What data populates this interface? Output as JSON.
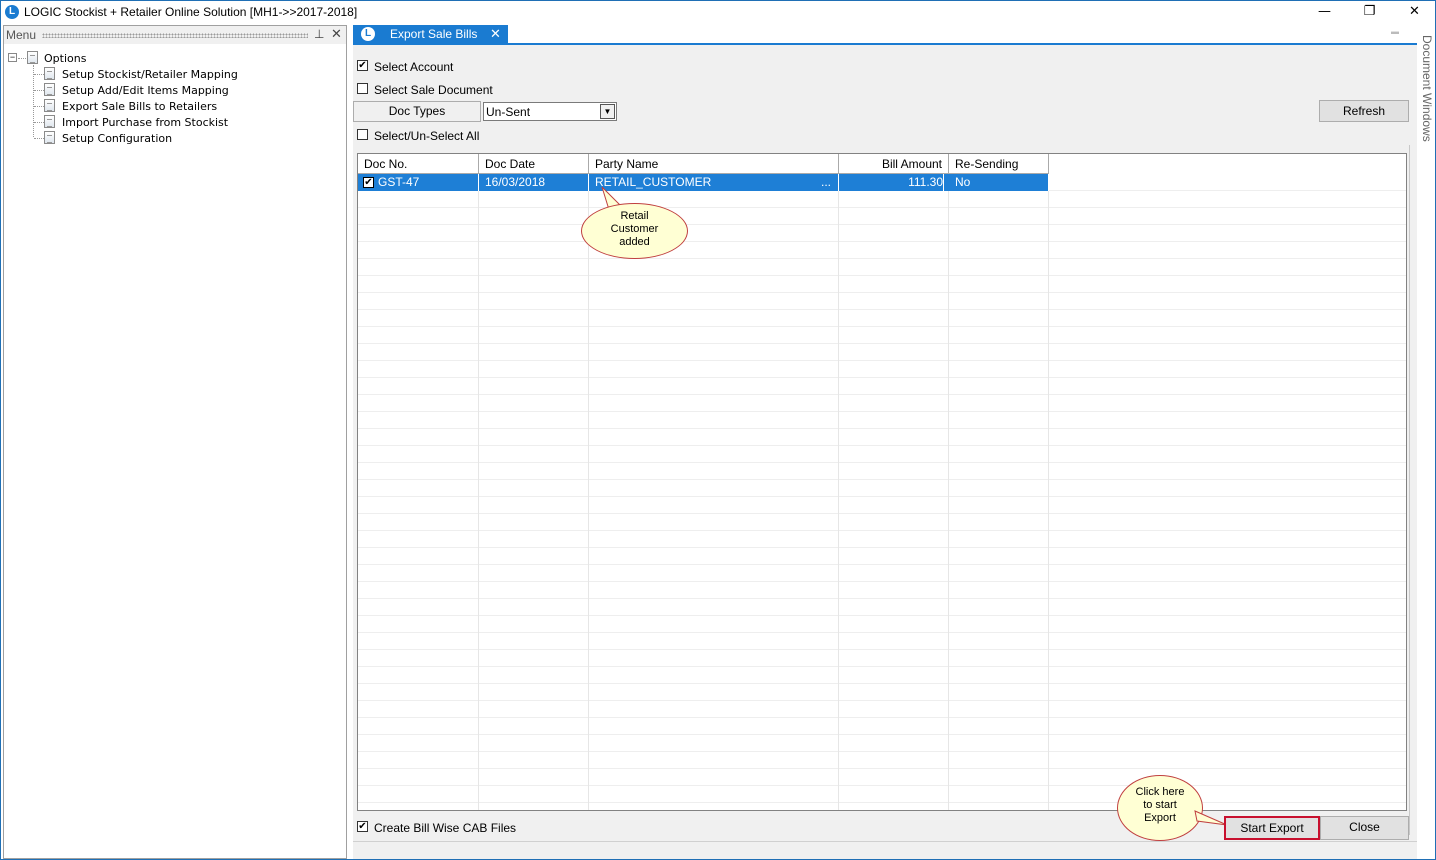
{
  "window": {
    "title": "LOGIC Stockist + Retailer Online Solution [MH1->>2017-2018]",
    "app_icon_letter": "L",
    "minimize_glyph": "—",
    "restore_glyph": "❐",
    "close_glyph": "✕"
  },
  "menu": {
    "title": "Menu",
    "pin_glyph": "📌",
    "close_glyph": "✕",
    "root": {
      "label": "Options",
      "expander": "−"
    },
    "items": [
      {
        "label": "Setup Stockist/Retailer Mapping"
      },
      {
        "label": "Setup Add/Edit Items Mapping"
      },
      {
        "label": "Export Sale Bills to Retailers"
      },
      {
        "label": "Import Purchase from Stockist"
      },
      {
        "label": "Setup Configuration"
      }
    ]
  },
  "tab": {
    "label": "Export Sale Bills",
    "icon_letter": "L",
    "close_glyph": "✕"
  },
  "side_panel": {
    "label": "Document Windows"
  },
  "form": {
    "select_account": {
      "label": "Select Account",
      "checked": true,
      "mark": "✔"
    },
    "select_sale_document": {
      "label": "Select Sale Document",
      "checked": false,
      "mark": ""
    },
    "doc_types": {
      "label": "Doc Types",
      "value": "Un-Sent",
      "arrow": "▼"
    },
    "refresh_label": "Refresh",
    "select_all": {
      "label": "Select/Un-Select All",
      "checked": false,
      "mark": ""
    },
    "create_cab": {
      "label": "Create Bill Wise CAB Files",
      "checked": true,
      "mark": "✔"
    },
    "start_export_label": "Start Export",
    "close_label": "Close"
  },
  "grid": {
    "columns": [
      "Doc No.",
      "Doc Date",
      "Party Name",
      "Bill Amount",
      "Re-Sending"
    ],
    "rows": [
      {
        "checked": true,
        "mark": "✔",
        "doc_no": "GST-47",
        "doc_date": "16/03/2018",
        "party_name": "RETAIL_CUSTOMER",
        "ellipsis": "...",
        "bill_amount": "111.30",
        "re_sending": "No"
      }
    ]
  },
  "callouts": {
    "retail": [
      "Retail",
      "Customer",
      "added"
    ],
    "export": [
      "Click here",
      "to start",
      "Export"
    ]
  },
  "colors": {
    "accent": "#1a7bd1",
    "selection": "#1e7fd6",
    "callout_fill": "#ffffd4",
    "highlight_border": "#c8102e"
  }
}
